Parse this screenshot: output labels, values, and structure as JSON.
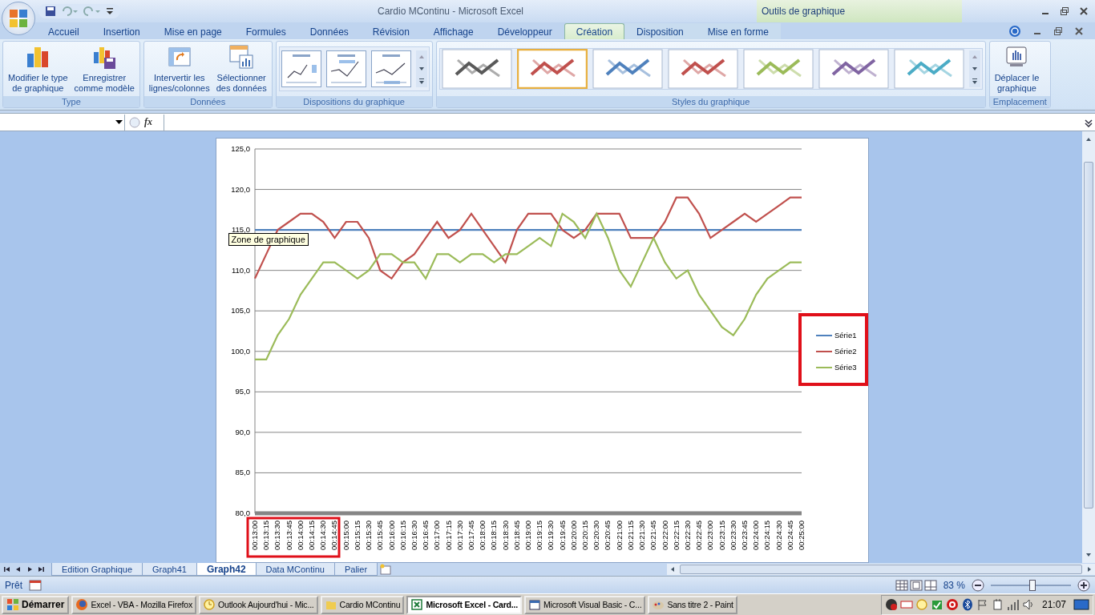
{
  "window": {
    "title": "Cardio MContinu - Microsoft Excel",
    "context_group": "Outils de graphique"
  },
  "ribbon_tabs": [
    {
      "label": "Accueil",
      "selected": false,
      "kind": "standard"
    },
    {
      "label": "Insertion",
      "selected": false,
      "kind": "standard"
    },
    {
      "label": "Mise en page",
      "selected": false,
      "kind": "standard"
    },
    {
      "label": "Formules",
      "selected": false,
      "kind": "standard"
    },
    {
      "label": "Données",
      "selected": false,
      "kind": "standard"
    },
    {
      "label": "Révision",
      "selected": false,
      "kind": "standard"
    },
    {
      "label": "Affichage",
      "selected": false,
      "kind": "standard"
    },
    {
      "label": "Développeur",
      "selected": false,
      "kind": "standard"
    },
    {
      "label": "Création",
      "selected": true,
      "kind": "contextual"
    },
    {
      "label": "Disposition",
      "selected": false,
      "kind": "contextual"
    },
    {
      "label": "Mise en forme",
      "selected": false,
      "kind": "contextual"
    }
  ],
  "ribbon_groups": [
    {
      "label": "Type",
      "kind": "buttons",
      "buttons": [
        {
          "kind": "change_type",
          "lines": [
            "Modifier le type",
            "de graphique"
          ]
        },
        {
          "kind": "save_template",
          "lines": [
            "Enregistrer",
            "comme modèle"
          ]
        }
      ]
    },
    {
      "label": "Données",
      "kind": "buttons",
      "buttons": [
        {
          "kind": "switch",
          "lines": [
            "Intervertir les",
            "lignes/colonnes"
          ]
        },
        {
          "kind": "select_data",
          "lines": [
            "Sélectionner",
            "des données"
          ]
        }
      ]
    },
    {
      "label": "Dispositions du graphique",
      "kind": "layouts"
    },
    {
      "label": "Styles du graphique",
      "kind": "styles",
      "styles": [
        {
          "color": "#595959",
          "selected": false
        },
        {
          "color": "#c0504d",
          "selected": true
        },
        {
          "color": "#4f81bd",
          "selected": false
        },
        {
          "color": "#c0504d",
          "selected": false
        },
        {
          "color": "#9bbb59",
          "selected": false
        },
        {
          "color": "#8064a2",
          "selected": false
        },
        {
          "color": "#4bacc6",
          "selected": false
        }
      ]
    },
    {
      "label": "Emplacement",
      "kind": "buttons",
      "buttons": [
        {
          "kind": "move_chart",
          "lines": [
            "Déplacer le",
            "graphique"
          ]
        }
      ]
    }
  ],
  "formula_bar": {
    "function_label": "fx"
  },
  "chart": {
    "tooltip": "Zone de graphique",
    "chart_data": {
      "type": "line",
      "categories": [
        "00:13:00",
        "00:13:15",
        "00:13:30",
        "00:13:45",
        "00:14:00",
        "00:14:15",
        "00:14:30",
        "00:14:45",
        "00:15:00",
        "00:15:15",
        "00:15:30",
        "00:15:45",
        "00:16:00",
        "00:16:15",
        "00:16:30",
        "00:16:45",
        "00:17:00",
        "00:17:15",
        "00:17:30",
        "00:17:45",
        "00:18:00",
        "00:18:15",
        "00:18:30",
        "00:18:45",
        "00:19:00",
        "00:19:15",
        "00:19:30",
        "00:19:45",
        "00:20:00",
        "00:20:15",
        "00:20:30",
        "00:20:45",
        "00:21:00",
        "00:21:15",
        "00:21:30",
        "00:21:45",
        "00:22:00",
        "00:22:15",
        "00:22:30",
        "00:22:45",
        "00:23:00",
        "00:23:15",
        "00:23:30",
        "00:23:45",
        "00:24:00",
        "00:24:15",
        "00:24:30",
        "00:24:45",
        "00:25:00"
      ],
      "series": [
        {
          "name": "Série1",
          "color": "#4f81bd",
          "values": [
            115,
            115,
            115,
            115,
            115,
            115,
            115,
            115,
            115,
            115,
            115,
            115,
            115,
            115,
            115,
            115,
            115,
            115,
            115,
            115,
            115,
            115,
            115,
            115,
            115,
            115,
            115,
            115,
            115,
            115,
            115,
            115,
            115,
            115,
            115,
            115,
            115,
            115,
            115,
            115,
            115,
            115,
            115,
            115,
            115,
            115,
            115,
            115,
            115
          ]
        },
        {
          "name": "Série2",
          "color": "#c0504d",
          "values": [
            109,
            112,
            115,
            116,
            117,
            117,
            116,
            114,
            116,
            116,
            114,
            110,
            109,
            111,
            112,
            114,
            116,
            114,
            115,
            117,
            115,
            113,
            111,
            115,
            117,
            117,
            117,
            115,
            114,
            115,
            117,
            117,
            117,
            114,
            114,
            114,
            116,
            119,
            119,
            117,
            114,
            115,
            116,
            117,
            116,
            117,
            118,
            119,
            119
          ]
        },
        {
          "name": "Série3",
          "color": "#9bbb59",
          "values": [
            99,
            99,
            102,
            104,
            107,
            109,
            111,
            111,
            110,
            109,
            110,
            112,
            112,
            111,
            111,
            109,
            112,
            112,
            111,
            112,
            112,
            111,
            112,
            112,
            113,
            114,
            113,
            117,
            116,
            114,
            117,
            114,
            110,
            108,
            111,
            114,
            111,
            109,
            110,
            107,
            105,
            103,
            102,
            104,
            107,
            109,
            110,
            111,
            111
          ]
        }
      ],
      "ylim": [
        80,
        125
      ],
      "grid": true,
      "legend": true,
      "yticks": [
        {
          "value": 80,
          "label": "80,0"
        },
        {
          "value": 85,
          "label": "85,0"
        },
        {
          "value": 90,
          "label": "90,0"
        },
        {
          "value": 95,
          "label": "95,0"
        },
        {
          "value": 100,
          "label": "100,0"
        },
        {
          "value": 105,
          "label": "105,0"
        },
        {
          "value": 110,
          "label": "110,0"
        },
        {
          "value": 115,
          "label": "115,0"
        },
        {
          "value": 120,
          "label": "120,0"
        },
        {
          "value": 125,
          "label": "125,0"
        }
      ]
    }
  },
  "sheet_tabs": [
    {
      "label": "Edition Graphique",
      "selected": false
    },
    {
      "label": "Graph41",
      "selected": false
    },
    {
      "label": "Graph42",
      "selected": true
    },
    {
      "label": "Data MContinu",
      "selected": false
    },
    {
      "label": "Palier",
      "selected": false
    }
  ],
  "status_bar": {
    "mode": "Prêt",
    "zoom": "83 %",
    "zoom_slider": {
      "level": 0.52
    }
  },
  "taskbar": {
    "start": "Démarrer",
    "clock": "21:07",
    "tasks": [
      {
        "label": "Excel - VBA - Mozilla Firefox",
        "kind": "firefox",
        "selected": false
      },
      {
        "label": "Outlook Aujourd'hui - Mic...",
        "kind": "outlook",
        "selected": false
      },
      {
        "label": "Cardio MContinu",
        "kind": "folder",
        "selected": false
      },
      {
        "label": "Microsoft Excel - Card...",
        "kind": "excel",
        "selected": true
      },
      {
        "label": "Microsoft Visual Basic - C...",
        "kind": "vba",
        "selected": false
      },
      {
        "label": "Sans titre 2 - Paint",
        "kind": "paint",
        "selected": false
      }
    ]
  }
}
